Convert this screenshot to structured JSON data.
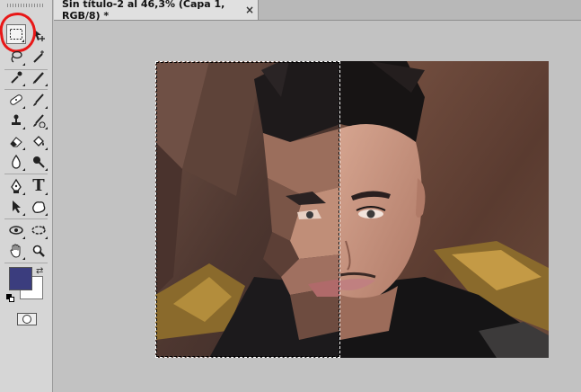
{
  "document": {
    "tab_title": "Sin título-2 al 46,3% (Capa 1, RGB/8) *",
    "close_glyph": "×"
  },
  "tools": [
    {
      "name": "rectangular-marquee-tool",
      "icon": "marquee-icon",
      "active": true
    },
    {
      "name": "move-tool",
      "icon": "move-icon"
    },
    {
      "name": "lasso-tool",
      "icon": "lasso-icon"
    },
    {
      "name": "magic-wand-tool",
      "icon": "magic-wand-icon"
    },
    {
      "name": "eyedropper-tool",
      "icon": "eyedropper-icon"
    },
    {
      "name": "brush-tool",
      "icon": "brush-icon"
    },
    {
      "name": "healing-brush-tool",
      "icon": "bandage-icon"
    },
    {
      "name": "clone-stamp-tool",
      "icon": "stamp-icon"
    },
    {
      "name": "history-brush-tool",
      "icon": "history-brush-icon"
    },
    {
      "name": "eraser-tool",
      "icon": "eraser-icon"
    },
    {
      "name": "paint-bucket-tool",
      "icon": "bucket-icon"
    },
    {
      "name": "blur-tool",
      "icon": "droplet-icon"
    },
    {
      "name": "dodge-tool",
      "icon": "dodge-icon"
    },
    {
      "name": "pen-tool",
      "icon": "pen-icon"
    },
    {
      "name": "type-tool",
      "icon": "type-icon",
      "label": "T"
    },
    {
      "name": "path-selection-tool",
      "icon": "arrow-icon"
    },
    {
      "name": "custom-shape-tool",
      "icon": "shape-icon"
    },
    {
      "name": "3d-rotate-tool",
      "icon": "rotate-3d-icon"
    },
    {
      "name": "3d-orbit-tool",
      "icon": "orbit-3d-icon"
    },
    {
      "name": "hand-tool",
      "icon": "hand-icon"
    },
    {
      "name": "zoom-tool",
      "icon": "zoom-icon"
    }
  ],
  "colors": {
    "foreground": "#3b3d7e",
    "background": "#ffffff",
    "annotation": "#e81717"
  }
}
